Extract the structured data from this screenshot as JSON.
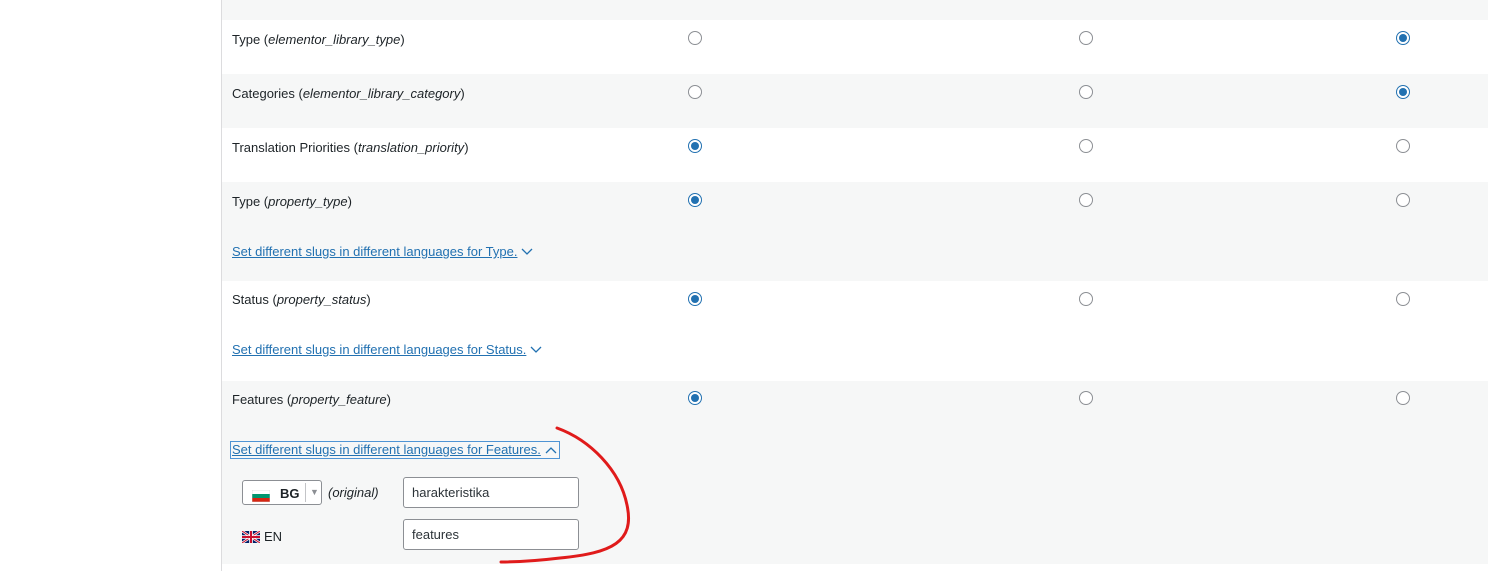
{
  "rows": [
    {
      "name": "Type",
      "slug": "elementor_library_type",
      "selected": 3
    },
    {
      "name": "Categories",
      "slug": "elementor_library_category",
      "selected": 3
    },
    {
      "name": "Translation Priorities",
      "slug": "translation_priority",
      "selected": 1
    },
    {
      "name": "Type",
      "slug": "property_type",
      "selected": 1,
      "link": "Set different slugs in different languages for Type."
    },
    {
      "name": "Status",
      "slug": "property_status",
      "selected": 1,
      "link": "Set different slugs in different languages for Status."
    },
    {
      "name": "Features",
      "slug": "property_feature",
      "selected": 1,
      "link": "Set different slugs in different languages for Features."
    }
  ],
  "slug_editor": {
    "original_lang": {
      "code": "BG",
      "flag": "bulgaria-flag-icon"
    },
    "original_marker": "(original)",
    "original_value": "harakteristika",
    "translation_lang": {
      "code": "EN",
      "flag": "uk-flag-icon"
    },
    "translation_value": "features"
  },
  "colors": {
    "accent": "#2271b1",
    "row_alt": "#f6f7f7",
    "annotation": "#e01b1b"
  }
}
